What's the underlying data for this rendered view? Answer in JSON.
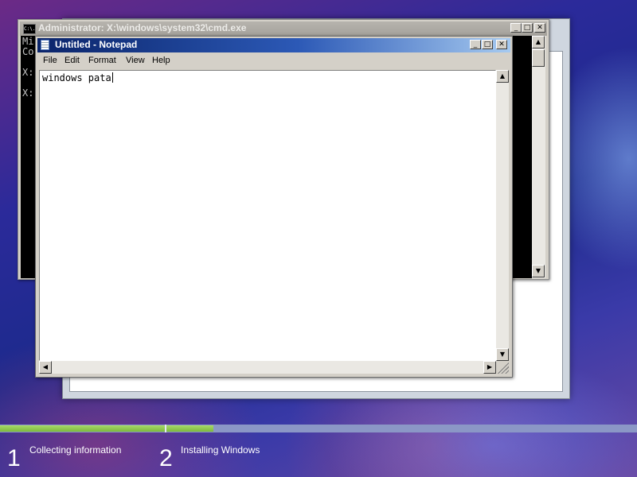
{
  "cmd_window": {
    "title": "Administrator: X:\\windows\\system32\\cmd.exe",
    "icon_label": "C:\\.",
    "lines": [
      "Mi",
      "Co",
      "",
      "X:",
      "",
      "X:"
    ],
    "minimize_symbol": "_",
    "maximize_symbol": "□",
    "close_symbol": "✕",
    "scroll_up_symbol": "▲",
    "scroll_down_symbol": "▼"
  },
  "notepad": {
    "title": "Untitled - Notepad",
    "menu": [
      "File",
      "Edit",
      "Format",
      "View",
      "Help"
    ],
    "content": "windows pata",
    "minimize_symbol": "_",
    "maximize_symbol": "□",
    "close_symbol": "✕",
    "scroll_up_symbol": "▲",
    "scroll_down_symbol": "▼",
    "scroll_left_symbol": "◀",
    "scroll_right_symbol": "▶"
  },
  "setup": {
    "steps": [
      {
        "number": "1",
        "label": "Collecting information",
        "progress": 1.0
      },
      {
        "number": "2",
        "label": "Installing Windows",
        "progress": 0.1
      }
    ],
    "progress_color": "#8fc850",
    "track_color": "#8b97c6"
  },
  "icons": {
    "cmd": "command-prompt-icon",
    "notepad": "notepad-icon"
  }
}
